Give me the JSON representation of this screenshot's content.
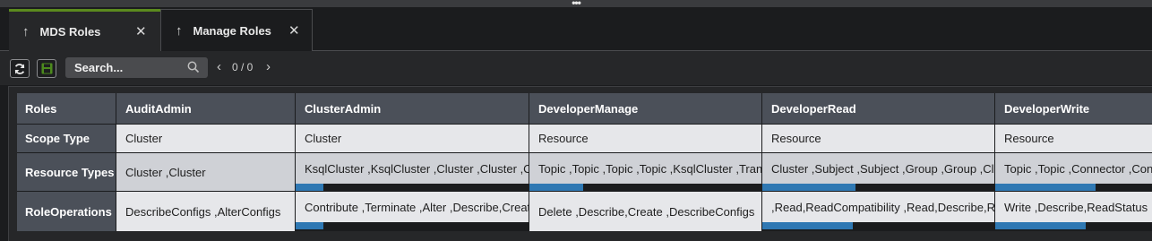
{
  "topbar": {
    "handle_label": "•••"
  },
  "tabs": [
    {
      "label": "MDS Roles",
      "active": true
    },
    {
      "label": "Manage Roles",
      "active": false
    }
  ],
  "toolbar": {
    "refresh_icon": "refresh-icon",
    "save_icon": "save-icon",
    "search_placeholder": "Search...",
    "pager_prev": "‹",
    "pager_text": "0 / 0",
    "pager_next": "›"
  },
  "colors": {
    "accent_green": "#5b8a1e",
    "scroll_thumb": "#2f78b3",
    "header_bg": "#4b5059"
  },
  "table": {
    "row_headers": [
      "Roles",
      "Scope Type",
      "Resource Types",
      "RoleOperations"
    ],
    "columns": [
      {
        "role": "AuditAdmin",
        "scope": "Cluster",
        "resource_types": "Cluster ,Cluster",
        "operations": "DescribeConfigs ,AlterConfigs",
        "scroll": {
          "resource_types": null,
          "operations": null
        }
      },
      {
        "role": "ClusterAdmin",
        "scope": "Cluster",
        "resource_types": "KsqlCluster ,KsqlCluster ,Cluster ,Cluster ,Cluster",
        "operations": "Contribute ,Terminate ,Alter ,Describe,Create",
        "scroll": {
          "resource_types": 0.12,
          "operations": 0.12
        }
      },
      {
        "role": "DeveloperManage",
        "scope": "Resource",
        "resource_types": "Topic ,Topic ,Topic ,Topic ,KsqlCluster ,Transaction",
        "operations": "Delete ,Describe,Create ,DescribeConfigs",
        "scroll": {
          "resource_types": 0.23,
          "operations": null
        }
      },
      {
        "role": "DeveloperRead",
        "scope": "Resource",
        "resource_types": "Cluster ,Subject ,Subject ,Group ,Group ,Cluster",
        "operations": ",Read,ReadCompatibility ,Read,Describe,Read",
        "scroll": {
          "resource_types": 0.4,
          "operations": 0.39
        }
      },
      {
        "role": "DeveloperWrite",
        "scope": "Resource",
        "resource_types": "Topic ,Topic ,Connector ,Connector",
        "operations": "Write ,Describe,ReadStatus",
        "scroll": {
          "resource_types": 0.43,
          "operations": 0.39
        }
      }
    ]
  }
}
